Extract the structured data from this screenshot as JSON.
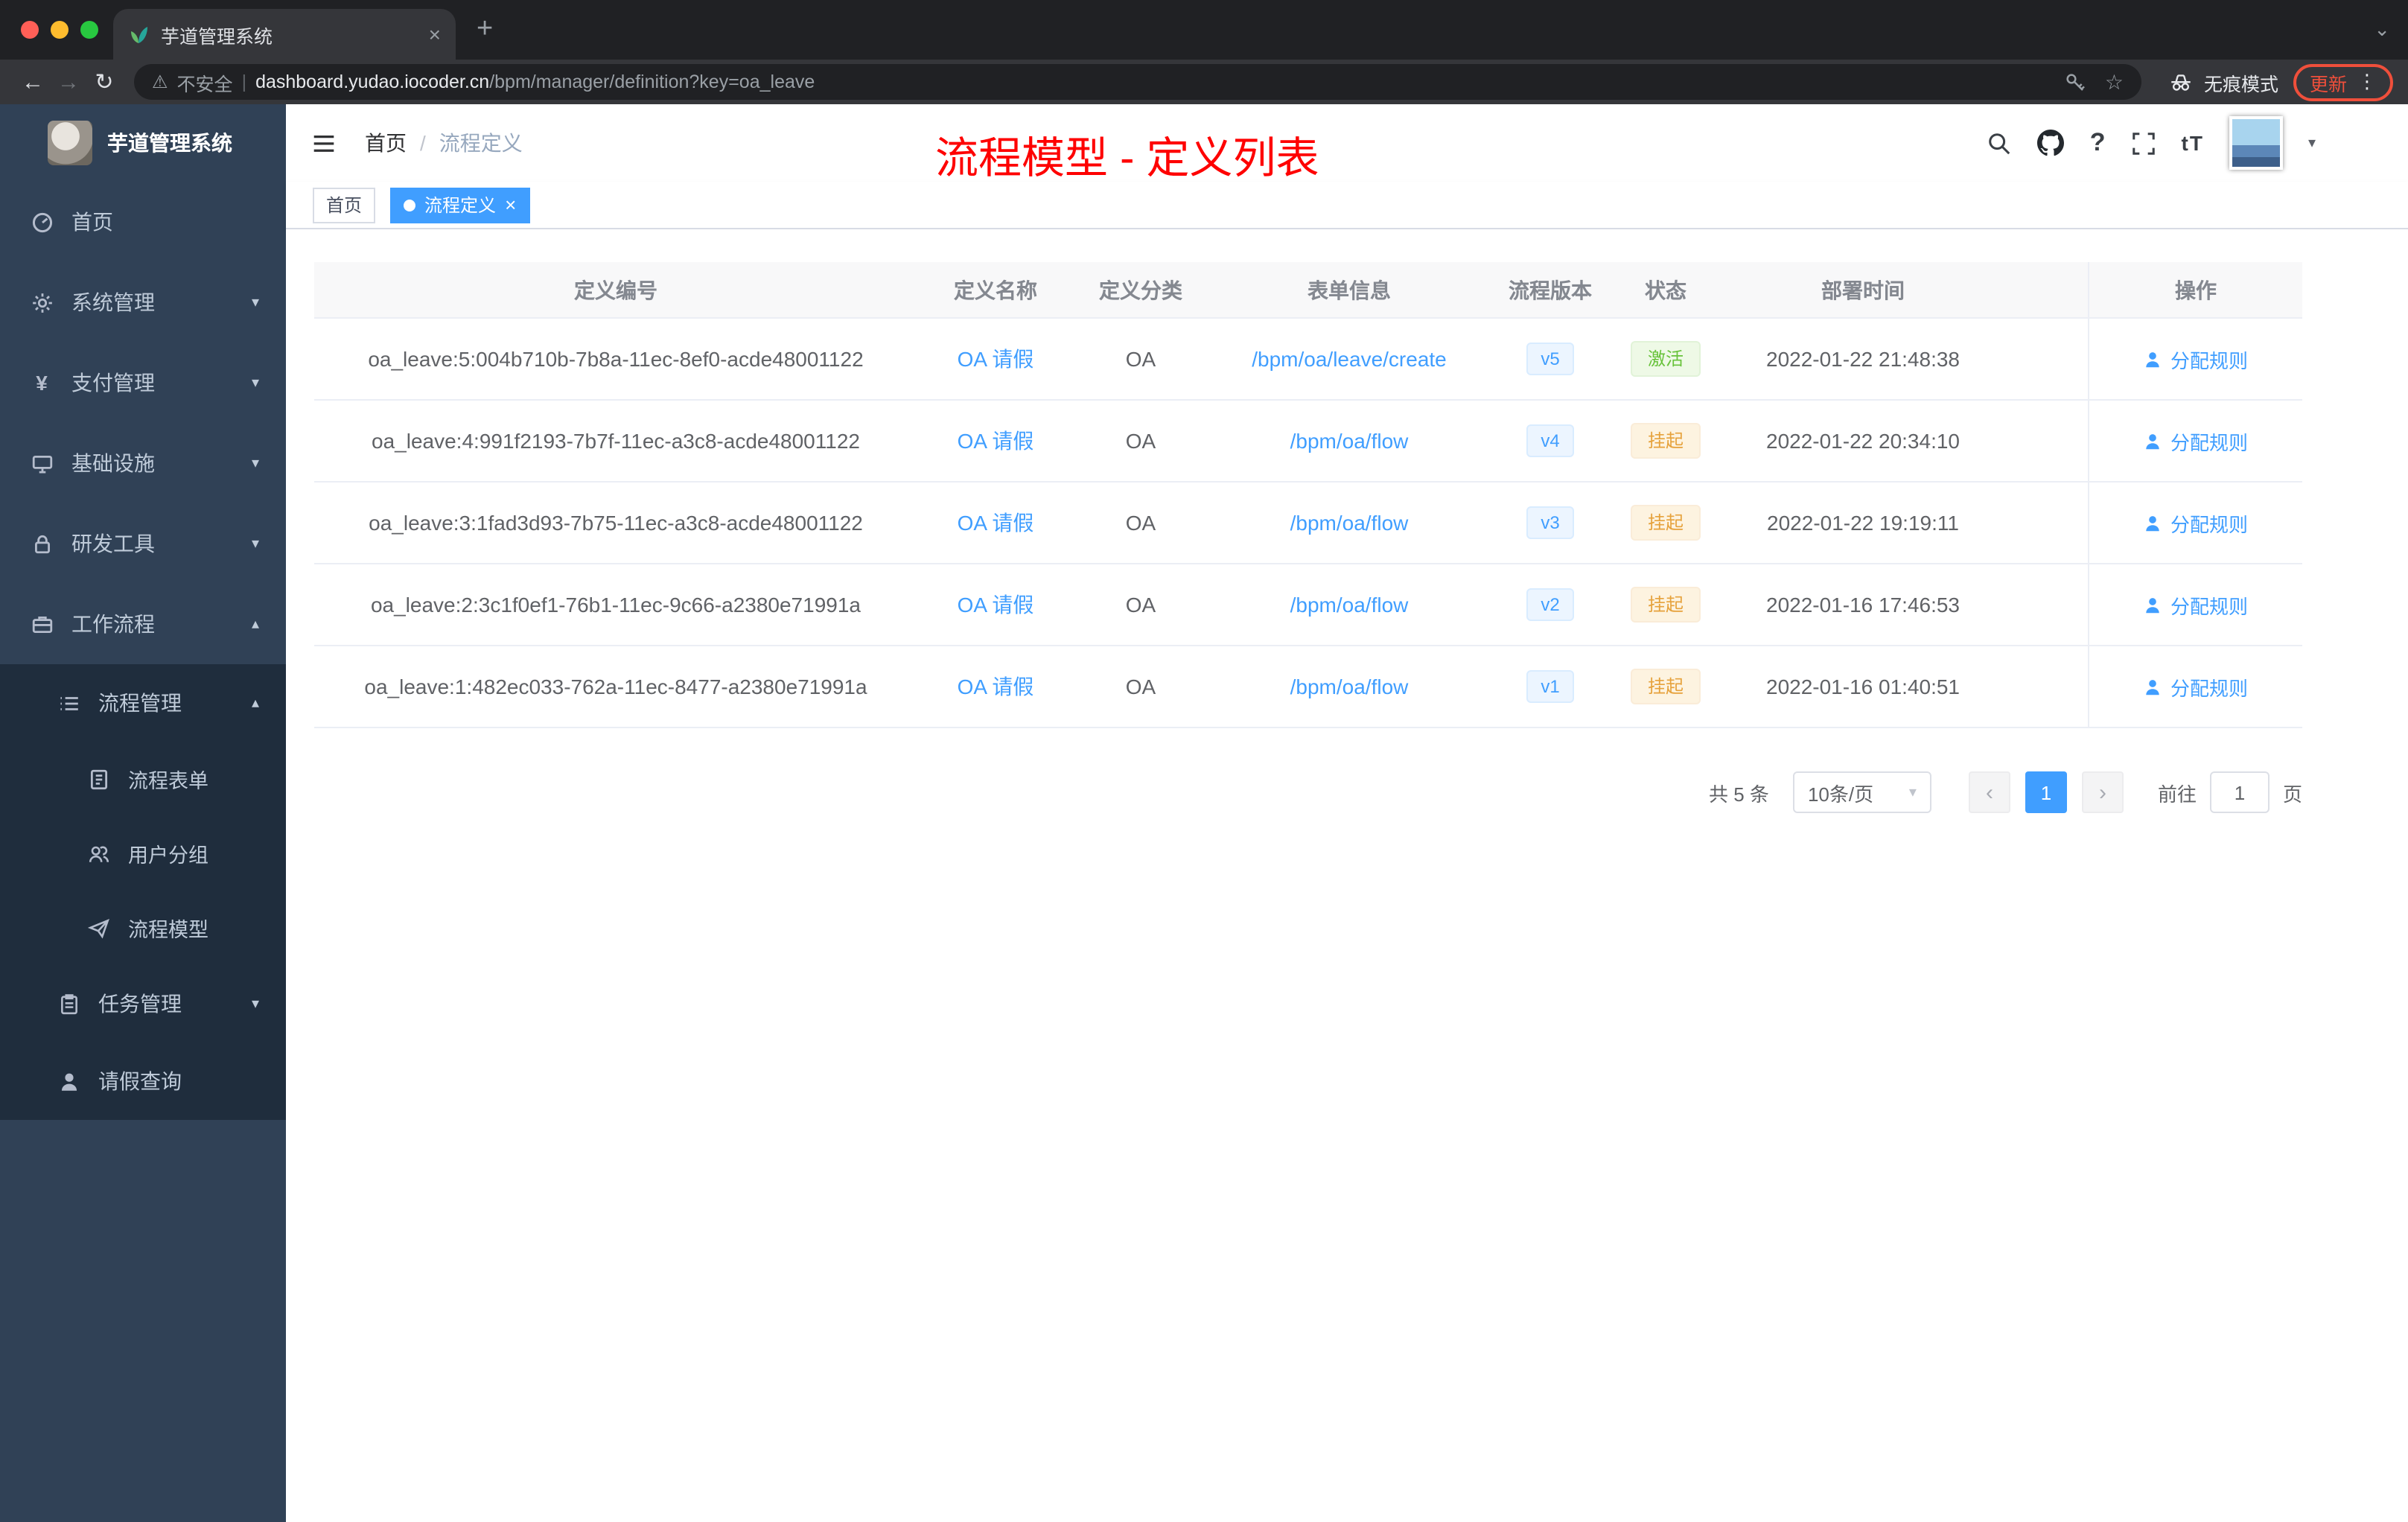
{
  "colors": {
    "accent": "#409EFF",
    "success": "#67C23A",
    "warning": "#E6A23C",
    "annotation_red": "#FE0000",
    "sidebar_bg": "#304156",
    "submenu_bg": "#1F2D3D"
  },
  "icons": {
    "close": "×",
    "new_tab": "+",
    "chevron_down": "⌄",
    "back": "←",
    "forward": "→",
    "reload": "↻",
    "warning": "⚠",
    "star": "☆",
    "more": "⋮",
    "caret_down": "▾",
    "caret_up": "▴",
    "prev": "‹",
    "next": "›",
    "question": "?",
    "font_size": "tT",
    "yen": "¥"
  },
  "browser": {
    "tab_title": "芋道管理系统",
    "security_label": "不安全",
    "url_host": "dashboard.yudao.iocoder.cn",
    "url_rest": "/bpm/manager/definition?key=oa_leave",
    "incognito_label": "无痕模式",
    "update_label": "更新"
  },
  "sidebar": {
    "logo_title": "芋道管理系统",
    "items": [
      {
        "label": "首页",
        "icon": "dashboard-icon",
        "level": 1
      },
      {
        "label": "系统管理",
        "icon": "gear-icon",
        "level": 1,
        "arrow": "down"
      },
      {
        "label": "支付管理",
        "icon": "yen-icon",
        "level": 1,
        "arrow": "down"
      },
      {
        "label": "基础设施",
        "icon": "monitor-icon",
        "level": 1,
        "arrow": "down"
      },
      {
        "label": "研发工具",
        "icon": "lock-icon",
        "level": 1,
        "arrow": "down"
      },
      {
        "label": "工作流程",
        "icon": "briefcase-icon",
        "level": 1,
        "arrow": "up"
      },
      {
        "label": "流程管理",
        "icon": "list-icon",
        "level": 2,
        "arrow": "up"
      },
      {
        "label": "流程表单",
        "icon": "form-icon",
        "level": 3
      },
      {
        "label": "用户分组",
        "icon": "users-icon",
        "level": 3
      },
      {
        "label": "流程模型",
        "icon": "send-icon",
        "level": 3
      },
      {
        "label": "任务管理",
        "icon": "clipboard-icon",
        "level": 2,
        "arrow": "down"
      },
      {
        "label": "请假查询",
        "icon": "user-icon",
        "level": 2
      }
    ]
  },
  "header": {
    "breadcrumb_home": "首页",
    "breadcrumb_sep": "/",
    "breadcrumb_current": "流程定义",
    "annotation": "流程模型 - 定义列表"
  },
  "tags": {
    "inactive": "首页",
    "active": "流程定义"
  },
  "table": {
    "columns": [
      "定义编号",
      "定义名称",
      "定义分类",
      "表单信息",
      "流程版本",
      "状态",
      "部署时间",
      "操作"
    ],
    "action_label": "分配规则",
    "rows": [
      {
        "id": "oa_leave:5:004b710b-7b8a-11ec-8ef0-acde48001122",
        "name": "OA 请假",
        "category": "OA",
        "form": "/bpm/oa/leave/create",
        "version": "v5",
        "status": "激活",
        "status_type": "success",
        "time": "2022-01-22 21:48:38"
      },
      {
        "id": "oa_leave:4:991f2193-7b7f-11ec-a3c8-acde48001122",
        "name": "OA 请假",
        "category": "OA",
        "form": "/bpm/oa/flow",
        "version": "v4",
        "status": "挂起",
        "status_type": "warning",
        "time": "2022-01-22 20:34:10"
      },
      {
        "id": "oa_leave:3:1fad3d93-7b75-11ec-a3c8-acde48001122",
        "name": "OA 请假",
        "category": "OA",
        "form": "/bpm/oa/flow",
        "version": "v3",
        "status": "挂起",
        "status_type": "warning",
        "time": "2022-01-22 19:19:11"
      },
      {
        "id": "oa_leave:2:3c1f0ef1-76b1-11ec-9c66-a2380e71991a",
        "name": "OA 请假",
        "category": "OA",
        "form": "/bpm/oa/flow",
        "version": "v2",
        "status": "挂起",
        "status_type": "warning",
        "time": "2022-01-16 17:46:53"
      },
      {
        "id": "oa_leave:1:482ec033-762a-11ec-8477-a2380e71991a",
        "name": "OA 请假",
        "category": "OA",
        "form": "/bpm/oa/flow",
        "version": "v1",
        "status": "挂起",
        "status_type": "warning",
        "time": "2022-01-16 01:40:51"
      }
    ]
  },
  "pagination": {
    "total": "共 5 条",
    "page_size": "10条/页",
    "current_page": "1",
    "goto_label": "前往",
    "goto_value": "1",
    "page_unit": "页"
  }
}
